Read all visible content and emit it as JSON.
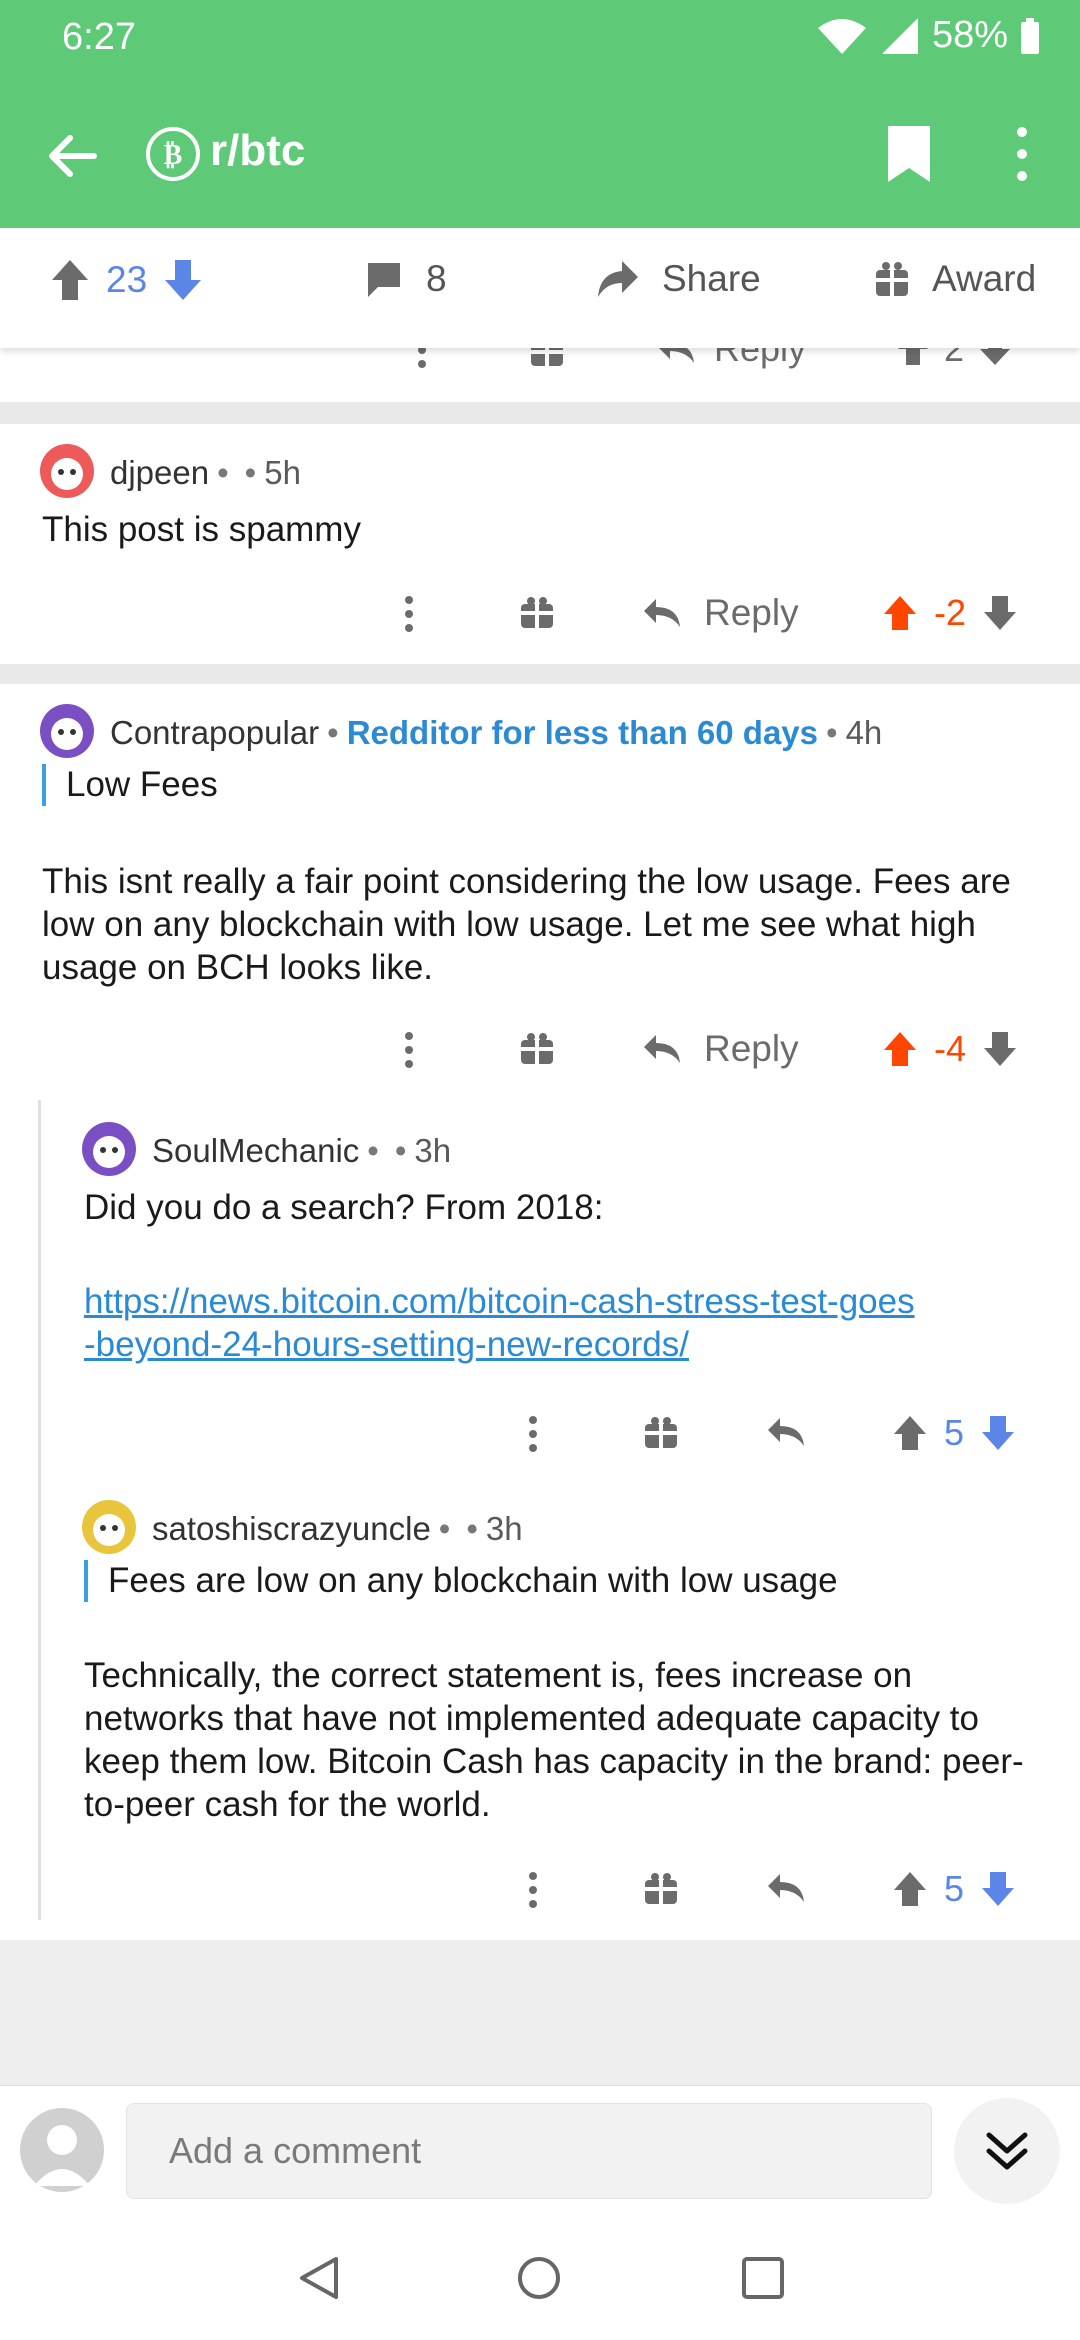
{
  "status_bar": {
    "time": "6:27",
    "battery": "58%"
  },
  "app_bar": {
    "title": "r/btc"
  },
  "post_actions": {
    "score": "23",
    "comments": "8",
    "share": "Share",
    "award": "Award"
  },
  "partial_row": {
    "reply": "Reply",
    "score": "2"
  },
  "comments": [
    {
      "user": "djpeen",
      "time": "5h",
      "body": "This post is spammy",
      "reply": "Reply",
      "score": "-2"
    },
    {
      "user": "Contrapopular",
      "flair": "Redditor for less than 60 days",
      "time": "4h",
      "quote": "Low Fees",
      "body": "This isnt really a fair point considering the low usage. Fees are low on any blockchain with low usage. Let me see what high usage on BCH looks like.",
      "reply": "Reply",
      "score": "-4"
    },
    {
      "user": "SoulMechanic",
      "time": "3h",
      "body": "Did you do a search? From 2018:",
      "link_line1": "https://news.bitcoin.com/bitcoin-cash-stress-test-goes",
      "link_line2": "-beyond-24-hours-setting-new-records/",
      "score": "5"
    },
    {
      "user": "satoshiscrazyuncle",
      "time": "3h",
      "quote": "Fees are low on any blockchain with low usage",
      "body": "Technically, the correct statement is, fees increase on networks that have not implemented adequate capacity to keep them low.  Bitcoin Cash has capacity in the brand: peer-to-peer cash for the world.",
      "score": "5"
    }
  ],
  "composer": {
    "placeholder": "Add a comment"
  },
  "colors": {
    "accent": "#5ec977",
    "upvote": "#ff4500",
    "vote_blue": "#5b86e8",
    "link": "#2a8ad6"
  }
}
